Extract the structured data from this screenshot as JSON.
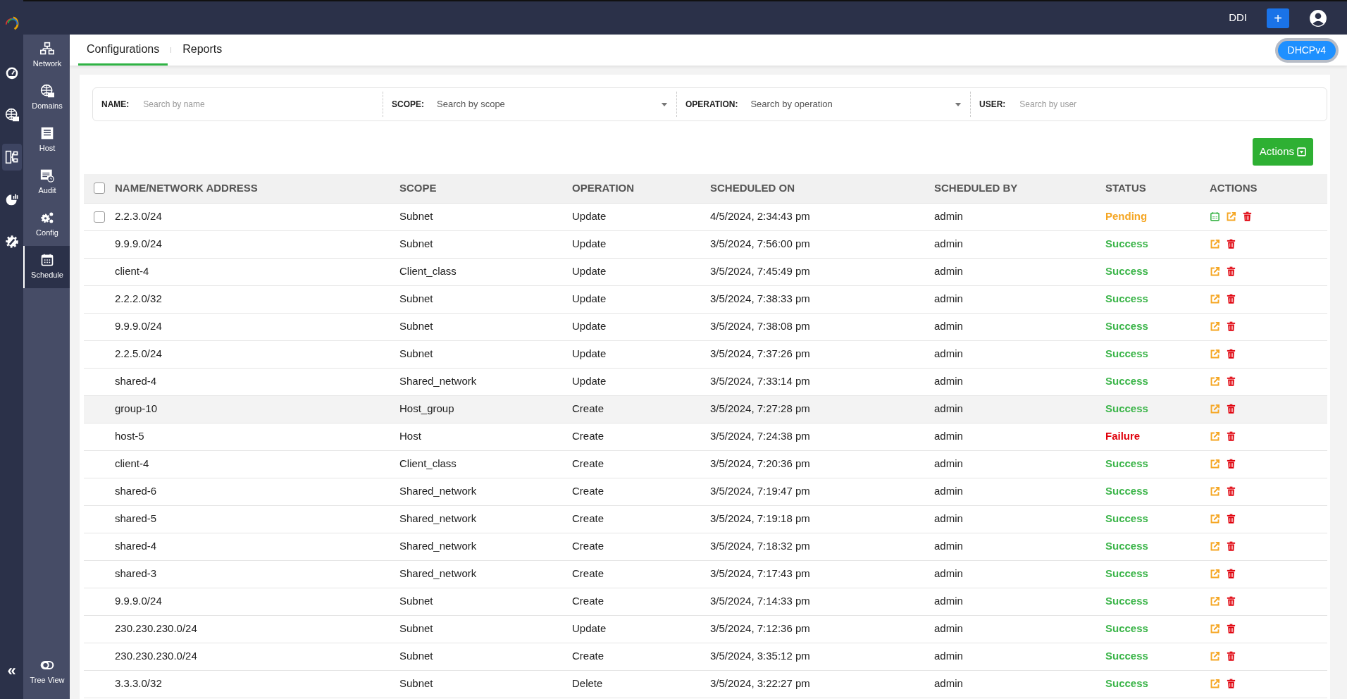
{
  "rail": {
    "items": [
      {
        "kind": "gauge",
        "selected": false
      },
      {
        "kind": "globe",
        "selected": false
      },
      {
        "kind": "diagram",
        "selected": true
      },
      {
        "kind": "chart",
        "selected": false
      },
      {
        "kind": "gear",
        "selected": false
      }
    ],
    "collapse": "«"
  },
  "topbar": {
    "product": "DDI",
    "add_button": "+"
  },
  "sidebar": {
    "items": [
      {
        "label": "Network",
        "kind": "network",
        "selected": false
      },
      {
        "label": "Domains",
        "kind": "globe",
        "selected": false
      },
      {
        "label": "Host",
        "kind": "host",
        "selected": false
      },
      {
        "label": "Audit",
        "kind": "audit",
        "selected": false
      },
      {
        "label": "Config",
        "kind": "gears",
        "selected": false
      },
      {
        "label": "Schedule",
        "kind": "calendar",
        "selected": true
      }
    ],
    "bottom": {
      "label": "Tree View"
    }
  },
  "tabs": [
    {
      "label": "Configurations",
      "selected": true
    },
    {
      "label": "Reports",
      "selected": false
    }
  ],
  "protocol_button": "DHCPv4",
  "filters": [
    {
      "label": "NAME:",
      "placeholder": "Search by name",
      "kind": "text"
    },
    {
      "label": "SCOPE:",
      "placeholder": "Search by scope",
      "kind": "select"
    },
    {
      "label": "OPERATION:",
      "placeholder": "Search by operation",
      "kind": "select"
    },
    {
      "label": "USER:",
      "placeholder": "Search by user",
      "kind": "text"
    }
  ],
  "actions_button": "Actions",
  "table": {
    "header_checkbox": {
      "checked": false
    },
    "columns": [
      "NAME/NETWORK ADDRESS",
      "SCOPE",
      "OPERATION",
      "SCHEDULED ON",
      "SCHEDULED BY",
      "STATUS",
      "ACTIONS"
    ],
    "rows": [
      {
        "name": "2.2.3.0/24",
        "scope": "Subnet",
        "operation": "Update",
        "scheduled_on": "4/5/2024, 2:34:43 pm",
        "scheduled_by": "admin",
        "status": "Pending",
        "color": "#f5a623",
        "checkbox": {
          "checked": false
        },
        "schedulable": true,
        "hovered": false
      },
      {
        "name": "9.9.9.0/24",
        "scope": "Subnet",
        "operation": "Update",
        "scheduled_on": "3/5/2024, 7:56:00 pm",
        "scheduled_by": "admin",
        "status": "Success",
        "color": "#3cb54a",
        "schedulable": false,
        "hovered": false
      },
      {
        "name": "client-4",
        "scope": "Client_class",
        "operation": "Update",
        "scheduled_on": "3/5/2024, 7:45:49 pm",
        "scheduled_by": "admin",
        "status": "Success",
        "color": "#3cb54a",
        "schedulable": false,
        "hovered": false
      },
      {
        "name": "2.2.2.0/32",
        "scope": "Subnet",
        "operation": "Update",
        "scheduled_on": "3/5/2024, 7:38:33 pm",
        "scheduled_by": "admin",
        "status": "Success",
        "color": "#3cb54a",
        "schedulable": false,
        "hovered": false
      },
      {
        "name": "9.9.9.0/24",
        "scope": "Subnet",
        "operation": "Update",
        "scheduled_on": "3/5/2024, 7:38:08 pm",
        "scheduled_by": "admin",
        "status": "Success",
        "color": "#3cb54a",
        "schedulable": false,
        "hovered": false
      },
      {
        "name": "2.2.5.0/24",
        "scope": "Subnet",
        "operation": "Update",
        "scheduled_on": "3/5/2024, 7:37:26 pm",
        "scheduled_by": "admin",
        "status": "Success",
        "color": "#3cb54a",
        "schedulable": false,
        "hovered": false
      },
      {
        "name": "shared-4",
        "scope": "Shared_network",
        "operation": "Update",
        "scheduled_on": "3/5/2024, 7:33:14 pm",
        "scheduled_by": "admin",
        "status": "Success",
        "color": "#3cb54a",
        "schedulable": false,
        "hovered": false
      },
      {
        "name": "group-10",
        "scope": "Host_group",
        "operation": "Create",
        "scheduled_on": "3/5/2024, 7:27:28 pm",
        "scheduled_by": "admin",
        "status": "Success",
        "color": "#3cb54a",
        "schedulable": false,
        "hovered": true
      },
      {
        "name": "host-5",
        "scope": "Host",
        "operation": "Create",
        "scheduled_on": "3/5/2024, 7:24:38 pm",
        "scheduled_by": "admin",
        "status": "Failure",
        "color": "#e0000b",
        "schedulable": false,
        "hovered": false
      },
      {
        "name": "client-4",
        "scope": "Client_class",
        "operation": "Create",
        "scheduled_on": "3/5/2024, 7:20:36 pm",
        "scheduled_by": "admin",
        "status": "Success",
        "color": "#3cb54a",
        "schedulable": false,
        "hovered": false
      },
      {
        "name": "shared-6",
        "scope": "Shared_network",
        "operation": "Create",
        "scheduled_on": "3/5/2024, 7:19:47 pm",
        "scheduled_by": "admin",
        "status": "Success",
        "color": "#3cb54a",
        "schedulable": false,
        "hovered": false
      },
      {
        "name": "shared-5",
        "scope": "Shared_network",
        "operation": "Create",
        "scheduled_on": "3/5/2024, 7:19:18 pm",
        "scheduled_by": "admin",
        "status": "Success",
        "color": "#3cb54a",
        "schedulable": false,
        "hovered": false
      },
      {
        "name": "shared-4",
        "scope": "Shared_network",
        "operation": "Create",
        "scheduled_on": "3/5/2024, 7:18:32 pm",
        "scheduled_by": "admin",
        "status": "Success",
        "color": "#3cb54a",
        "schedulable": false,
        "hovered": false
      },
      {
        "name": "shared-3",
        "scope": "Shared_network",
        "operation": "Create",
        "scheduled_on": "3/5/2024, 7:17:43 pm",
        "scheduled_by": "admin",
        "status": "Success",
        "color": "#3cb54a",
        "schedulable": false,
        "hovered": false
      },
      {
        "name": "9.9.9.0/24",
        "scope": "Subnet",
        "operation": "Create",
        "scheduled_on": "3/5/2024, 7:14:33 pm",
        "scheduled_by": "admin",
        "status": "Success",
        "color": "#3cb54a",
        "schedulable": false,
        "hovered": false
      },
      {
        "name": "230.230.230.0/24",
        "scope": "Subnet",
        "operation": "Update",
        "scheduled_on": "3/5/2024, 7:12:36 pm",
        "scheduled_by": "admin",
        "status": "Success",
        "color": "#3cb54a",
        "schedulable": false,
        "hovered": false
      },
      {
        "name": "230.230.230.0/24",
        "scope": "Subnet",
        "operation": "Create",
        "scheduled_on": "3/5/2024, 3:35:12 pm",
        "scheduled_by": "admin",
        "status": "Success",
        "color": "#3cb54a",
        "schedulable": false,
        "hovered": false
      },
      {
        "name": "3.3.3.0/32",
        "scope": "Subnet",
        "operation": "Delete",
        "scheduled_on": "3/5/2024, 3:22:27 pm",
        "scheduled_by": "admin",
        "status": "Success",
        "color": "#3cb54a",
        "schedulable": false,
        "hovered": false
      }
    ]
  }
}
